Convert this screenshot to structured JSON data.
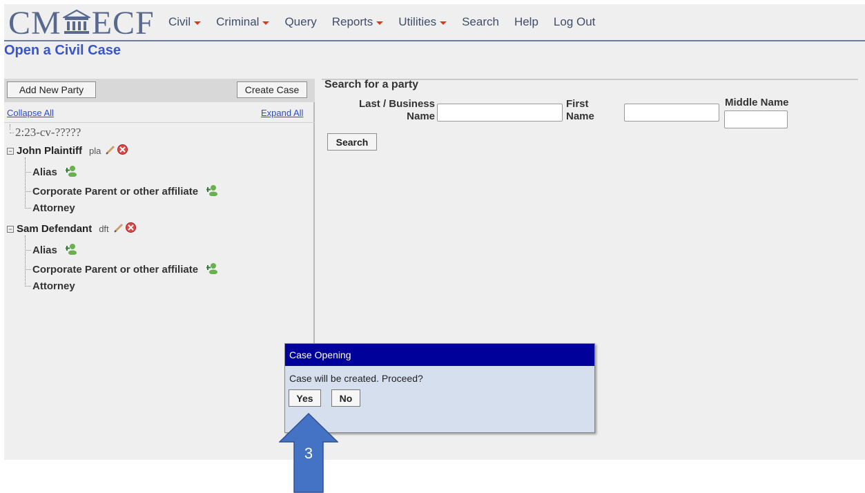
{
  "header": {
    "logo_left": "CM",
    "logo_right": "ECF",
    "nav": [
      {
        "label": "Civil",
        "dropdown": true
      },
      {
        "label": "Criminal",
        "dropdown": true
      },
      {
        "label": "Query",
        "dropdown": false
      },
      {
        "label": "Reports",
        "dropdown": true
      },
      {
        "label": "Utilities",
        "dropdown": true
      },
      {
        "label": "Search",
        "dropdown": false
      },
      {
        "label": "Help",
        "dropdown": false
      },
      {
        "label": "Log Out",
        "dropdown": false
      }
    ]
  },
  "page": {
    "title": "Open a Civil Case"
  },
  "left": {
    "add_party_label": "Add New Party",
    "create_case_label": "Create Case",
    "collapse_all": "Collapse All",
    "expand_all": "Expand All",
    "case_number": "2:23-cv-?????",
    "parties": [
      {
        "name": "John Plaintiff",
        "role": "pla",
        "children": [
          "Alias",
          "Corporate Parent or other affiliate",
          "Attorney"
        ]
      },
      {
        "name": "Sam Defendant",
        "role": "dft",
        "children": [
          "Alias",
          "Corporate Parent or other affiliate",
          "Attorney"
        ]
      }
    ]
  },
  "search": {
    "title": "Search for a party",
    "last_label_1": "Last / Business",
    "last_label_2": "Name",
    "first_label_1": "First",
    "first_label_2": "Name",
    "middle_label": "Middle Name",
    "last_value": "",
    "first_value": "",
    "middle_value": "",
    "button": "Search"
  },
  "modal": {
    "title": "Case Opening",
    "message": "Case will be created. Proceed?",
    "yes": "Yes",
    "no": "No"
  },
  "annotation": {
    "step": "3"
  },
  "colors": {
    "title_blue": "#3a55c9",
    "modal_header": "#00009a",
    "modal_bg": "#d5dfee",
    "arrow": "#4472c4"
  }
}
